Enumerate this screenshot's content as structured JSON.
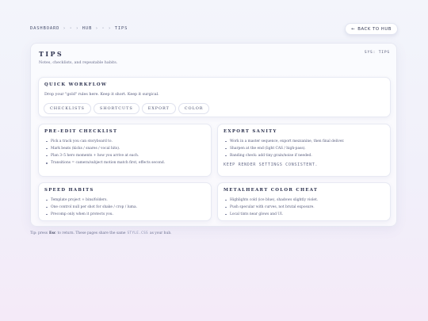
{
  "breadcrumb": {
    "items": [
      "DASHBOARD",
      "·",
      "HUB",
      "·",
      "TIPS"
    ],
    "separators": [
      "›",
      "›",
      "›",
      "›"
    ]
  },
  "back_button": {
    "icon": "arrow-left-icon",
    "label": "BACK TO HUB",
    "arrow": "←"
  },
  "panel": {
    "title": "TIPS",
    "subtitle": "Notes, checklists, and repeatable habits.",
    "tag": "SYS: TIPS"
  },
  "quick_workflow": {
    "title": "QUICK WORKFLOW",
    "text": "Drop your \"gold\" rules here. Keep it short. Keep it surgical.",
    "chips": [
      "CHECKLISTS",
      "SHORTCUTS",
      "EXPORT",
      "COLOR"
    ]
  },
  "pre_edit": {
    "title": "PRE-EDIT CHECKLIST",
    "items": [
      "Pick a track you can storyboard to.",
      "Mark beats (kicks / snares / vocal hits).",
      "Plan 3–5 hero moments + how you arrive at each.",
      "Transitions = camera/subject motion match first, effects second."
    ]
  },
  "export_sanity": {
    "title": "EXPORT SANITY",
    "items": [
      "Work in a master sequence, export mezzanine, then final deliver.",
      "Sharpen at the end (light CAS / high-pass).",
      "Banding check: add tiny grain/noise if needed."
    ],
    "note": "KEEP RENDER SETTINGS CONSISTENT."
  },
  "speed_habits": {
    "title": "SPEED HABITS",
    "items": [
      "Template project + bins/folders.",
      "One control null per shot for shake / crop / luma.",
      "Precomp only when it protects you."
    ]
  },
  "metalheart": {
    "title": "METALHEART COLOR CHEAT",
    "items": [
      "Highlights cold (ice blue), shadows slightly violet.",
      "Push specular with curves, not brutal exposure.",
      "Local tints near glows and UI."
    ]
  },
  "footer": {
    "prefix": "Tip: press",
    "key": "Esc",
    "middle": "to return. These pages share the same",
    "code": "STYLE.CSS",
    "suffix": "as your hub."
  }
}
